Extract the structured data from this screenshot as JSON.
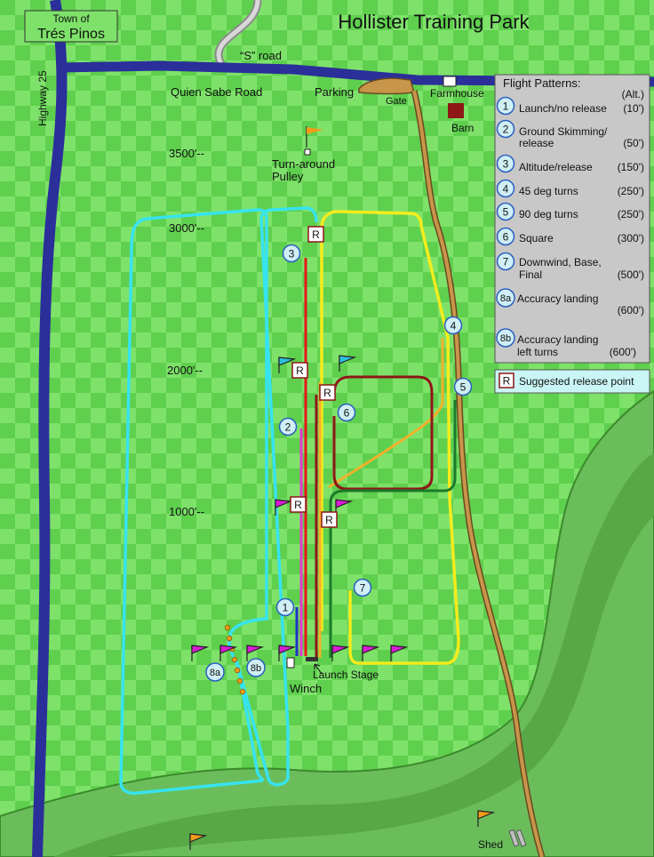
{
  "title": "Hollister Training Park",
  "town": {
    "line1": "Town of",
    "line2": "Trés Pinos"
  },
  "roads": {
    "highway": "Highway 25",
    "s_road": "“S” road",
    "quien_sabe": "Quien Sabe Road",
    "parking": "Parking",
    "gate": "Gate",
    "farmhouse": "Farmhouse",
    "barn": "Barn",
    "shed": "Shed"
  },
  "pulley": {
    "line1": "Turn-around",
    "line2": "Pulley"
  },
  "winch": "Winch",
  "launch_stage": "Launch Stage",
  "altitude_marks": [
    "3500'--",
    "3000'--",
    "2000'--",
    "1000'--"
  ],
  "release_symbol": "R",
  "pattern_numbers": [
    "1",
    "2",
    "3",
    "4",
    "5",
    "6",
    "7",
    "8a",
    "8b"
  ],
  "legend": {
    "title": "Flight Patterns:",
    "alt_header": "(Alt.)",
    "items": [
      {
        "num": "1",
        "label": "Launch/no release",
        "alt": "(10')"
      },
      {
        "num": "2",
        "label": "Ground Skimming/",
        "label2": "release",
        "alt": "(50')"
      },
      {
        "num": "3",
        "label": "Altitude/release",
        "alt": "(150')"
      },
      {
        "num": "4",
        "label": "45 deg turns",
        "alt": "(250')"
      },
      {
        "num": "5",
        "label": "90 deg turns",
        "alt": "(250')"
      },
      {
        "num": "6",
        "label": "Square",
        "alt": "(300')"
      },
      {
        "num": "7",
        "label": "Downwind, Base,",
        "label2": "Final",
        "alt": "(500')"
      },
      {
        "num": "8a",
        "label": "Accuracy landing",
        "alt": "(600')"
      },
      {
        "num": "8b",
        "label": "Accuracy landing",
        "label2": "left turns",
        "alt": "(600')"
      }
    ]
  },
  "release_legend": "Suggested release point",
  "colors": {
    "grass_light": "#7ee26a",
    "grass_check": "#5fcf4e",
    "highway": "#2a2f9a",
    "dirt_road": "#c8964a",
    "dark_green_band": "#6bbd5c",
    "legend_bg": "#c8c8c8",
    "circle_fill": "#cfeff5",
    "circle_stroke": "#2a5fc0",
    "cyan": "#36e3f0",
    "yellow": "#f5ec1c",
    "orange": "#f2b02a",
    "red": "#e51818",
    "magenta": "#e43ad2",
    "blue": "#2030c8",
    "dark_red": "#8e1717",
    "dark_green": "#1a7a2a",
    "flag_magenta": "#d81bd2",
    "flag_cyan": "#2bc0dc",
    "flag_orange": "#f29a1a"
  }
}
